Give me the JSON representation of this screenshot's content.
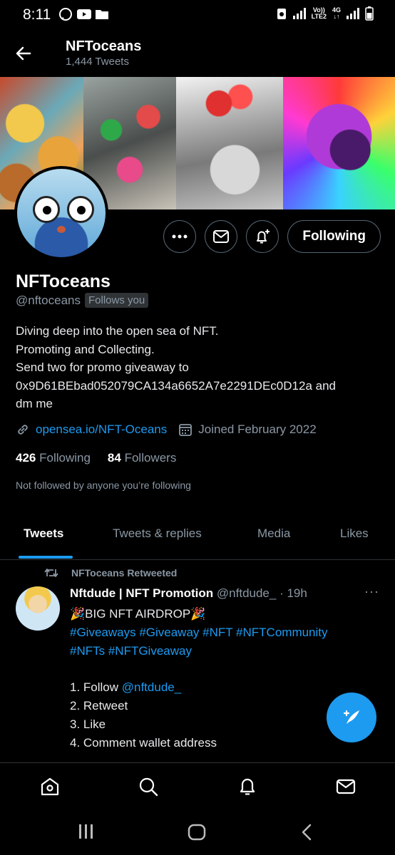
{
  "status_bar": {
    "time": "8:11",
    "volte": "Vo))",
    "lte": "LTE2",
    "net": "4G"
  },
  "header": {
    "title": "NFToceans",
    "subtitle": "1,444 Tweets"
  },
  "profile": {
    "follow_button": "Following",
    "name": "NFToceans",
    "handle": "@nftoceans",
    "follows_you": "Follows you",
    "bio": [
      "Diving deep into the open sea of NFT.",
      "Promoting and Collecting.",
      "Send two for promo giveaway to",
      "0x9D61BEbad052079CA134a6652A7e2291DEc0D12a and",
      "dm me"
    ],
    "link": "opensea.io/NFT-Oceans",
    "joined": "Joined February 2022",
    "following_count": "426",
    "following_label": "Following",
    "followers_count": "84",
    "followers_label": "Followers",
    "not_followed": "Not followed by anyone you’re following"
  },
  "tabs": [
    "Tweets",
    "Tweets & replies",
    "Media",
    "Likes"
  ],
  "tweet": {
    "retweeted_by": "NFToceans Retweeted",
    "author_name": "Nftdude | NFT Promotion",
    "author_handle": "@nftdude_",
    "time": "· 19h",
    "more": "···",
    "line1": "🎉BIG NFT AIRDROP🎉",
    "line2": "#Giveaways #Giveaway #NFT #NFTCommunity",
    "line3": "#NFTs #NFTGiveaway",
    "line5_prefix": "1. Follow ",
    "line5_mention": "@nftdude_",
    "line6": "2. Retweet",
    "line7": "3. Like",
    "line8": "4. Comment wallet address"
  },
  "colors": {
    "accent": "#1d9bf0",
    "background": "#000000",
    "muted": "#8b98a5"
  },
  "icons": [
    "back-arrow-icon",
    "more-icon",
    "message-icon",
    "notify-bell-icon",
    "link-icon",
    "calendar-icon",
    "retweet-icon",
    "compose-icon",
    "home-icon",
    "search-icon",
    "bell-icon",
    "mail-icon"
  ]
}
